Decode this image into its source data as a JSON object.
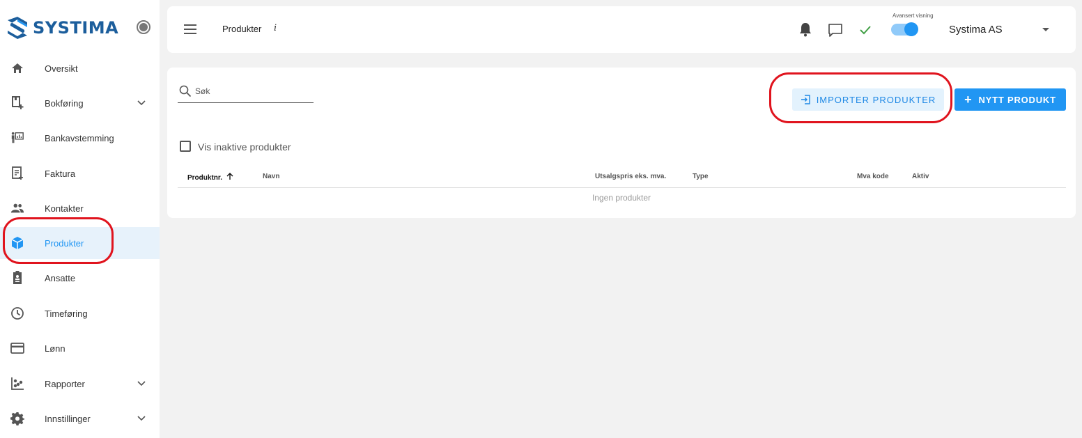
{
  "brand": {
    "name": "SYSTIMA"
  },
  "sidebar": {
    "items": [
      {
        "label": "Oversikt",
        "icon": "home-icon"
      },
      {
        "label": "Bokføring",
        "icon": "bookkeeping-icon",
        "expandable": true
      },
      {
        "label": "Bankavstemming",
        "icon": "bank-reconciliation-icon"
      },
      {
        "label": "Faktura",
        "icon": "invoice-icon"
      },
      {
        "label": "Kontakter",
        "icon": "contacts-icon"
      },
      {
        "label": "Produkter",
        "icon": "product-box-icon",
        "active": true
      },
      {
        "label": "Ansatte",
        "icon": "employee-badge-icon"
      },
      {
        "label": "Timeføring",
        "icon": "clock-icon"
      },
      {
        "label": "Lønn",
        "icon": "payment-card-icon"
      },
      {
        "label": "Rapporter",
        "icon": "reports-chart-icon",
        "expandable": true
      },
      {
        "label": "Innstillinger",
        "icon": "settings-gear-icon",
        "expandable": true
      }
    ]
  },
  "header": {
    "title": "Produkter",
    "info_glyph": "i",
    "toggle_label": "Avansert visning",
    "toggle_on": true,
    "company": "Systima AS"
  },
  "main": {
    "search_placeholder": "Søk",
    "import_button": "IMPORTER PRODUKTER",
    "new_button": "NYTT PRODUKT",
    "checkbox_label": "Vis inaktive produkter",
    "columns": [
      "Produktnr.",
      "Navn",
      "Utsalgspris eks. mva.",
      "Type",
      "Mva kode",
      "Aktiv"
    ],
    "empty_text": "Ingen produkter"
  },
  "colors": {
    "accent": "#2196f3",
    "brand": "#1c5e9c",
    "annotation": "#e0141e",
    "check": "#43a047"
  }
}
